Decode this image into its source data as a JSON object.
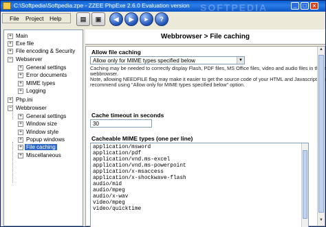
{
  "window": {
    "title": "C:\\Softpedia\\Softpedia.zpe - ZZEE PhpExe 2.6.0 Evaluation version"
  },
  "watermark": "SOFTPEDIA",
  "menu": [
    "File",
    "Project",
    "Help"
  ],
  "toolbar": {
    "icons": [
      "new-document-icon",
      "save-icon",
      "back-icon",
      "forward-icon",
      "run-icon",
      "help-icon"
    ]
  },
  "sidebar": {
    "items": [
      {
        "label": "Main",
        "expander": "+"
      },
      {
        "label": "Exe file",
        "expander": "+"
      },
      {
        "label": "File encoding & Security",
        "expander": "+"
      },
      {
        "label": "Webserver",
        "expander": "−"
      },
      {
        "label": "General settings",
        "expander": "+"
      },
      {
        "label": "Error documents",
        "expander": "+"
      },
      {
        "label": "MIME types",
        "expander": "+"
      },
      {
        "label": "Logging",
        "expander": "+"
      },
      {
        "label": "Php.ini",
        "expander": "+"
      },
      {
        "label": "Webbrowser",
        "expander": "−"
      },
      {
        "label": "General settings",
        "expander": "+"
      },
      {
        "label": "Window size",
        "expander": "+"
      },
      {
        "label": "Window style",
        "expander": "+"
      },
      {
        "label": "Popup windows",
        "expander": "+"
      },
      {
        "label": "File caching",
        "expander": "+"
      },
      {
        "label": "Miscellaneous",
        "expander": "+"
      }
    ]
  },
  "main": {
    "header": "Webbrowser > File caching",
    "allow": {
      "label": "Allow file caching",
      "selected": "Allow only for MIME types specified below",
      "note": [
        "Caching may be needed to correctly display Flash, PDF files, MS Office files, video and audio files in the internal",
        "webbrowser.",
        "Note, allowing NEEDFILE flag may make it easier to get the source code of your HTML and Javascript files, we",
        "recommend using \"Allow only for MIME types specified below\" option."
      ]
    },
    "timeout": {
      "label": "Cache timeout in seconds",
      "value": "30"
    },
    "mime": {
      "label": "Cacheable MIME types (one per line)",
      "lines": [
        "application/msword",
        "application/pdf",
        "application/vnd.ms-excel",
        "application/vnd.ms-powerpoint",
        "application/x-msaccess",
        "application/x-shockwave-flash",
        "audio/mid",
        "audio/mpeg",
        "audio/x-wav",
        "video/mpeg",
        "video/quicktime"
      ]
    }
  }
}
